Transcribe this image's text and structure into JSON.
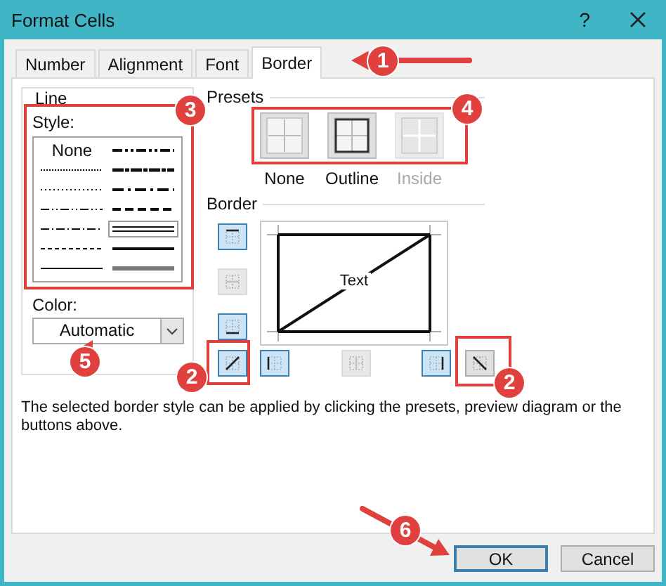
{
  "window": {
    "title": "Format Cells",
    "help": "?"
  },
  "tabs": [
    {
      "label": "Number",
      "selected": false
    },
    {
      "label": "Alignment",
      "selected": false
    },
    {
      "label": "Font",
      "selected": false
    },
    {
      "label": "Border",
      "selected": true
    }
  ],
  "line": {
    "title": "Line",
    "style_label": "Style:",
    "styles": [
      {
        "kind": "none",
        "label": "None",
        "selected": false
      },
      {
        "kind": "mdashdotdot",
        "selected": false
      },
      {
        "kind": "hair",
        "selected": false
      },
      {
        "kind": "slantdashdot",
        "selected": false
      },
      {
        "kind": "dotted",
        "selected": false
      },
      {
        "kind": "mdashdot",
        "selected": false
      },
      {
        "kind": "dashdotdot",
        "selected": false
      },
      {
        "kind": "mdashed",
        "selected": false
      },
      {
        "kind": "dashdot",
        "selected": false
      },
      {
        "kind": "double",
        "selected": true
      },
      {
        "kind": "dashed",
        "selected": false
      },
      {
        "kind": "medium",
        "selected": false
      },
      {
        "kind": "thin",
        "selected": false
      },
      {
        "kind": "thick",
        "selected": false
      }
    ],
    "color_label": "Color:",
    "color_value": "Automatic"
  },
  "presets": {
    "title": "Presets",
    "items": [
      {
        "kind": "none",
        "label": "None",
        "disabled": false
      },
      {
        "kind": "outline",
        "label": "Outline",
        "disabled": false
      },
      {
        "kind": "inside",
        "label": "Inside",
        "disabled": true
      }
    ]
  },
  "border": {
    "title": "Border",
    "preview_text": "Text",
    "side_buttons": [
      {
        "kind": "top",
        "on": true,
        "disabled": false
      },
      {
        "kind": "middle",
        "on": false,
        "disabled": true
      },
      {
        "kind": "bottom",
        "on": true,
        "disabled": false
      }
    ],
    "bottom_buttons": [
      {
        "kind": "diagonal_up",
        "on": true,
        "disabled": false
      },
      {
        "kind": "left",
        "on": true,
        "disabled": false
      },
      {
        "kind": "center",
        "on": false,
        "disabled": true
      },
      {
        "kind": "right",
        "on": true,
        "disabled": false
      },
      {
        "kind": "diagonal_down",
        "on": false,
        "disabled": false
      }
    ]
  },
  "help_text": "The selected border style can be applied by clicking the presets, preview diagram or the buttons above.",
  "buttons": [
    {
      "label": "OK",
      "default": true
    },
    {
      "label": "Cancel",
      "default": false
    }
  ],
  "annotations": [
    {
      "label": "1"
    },
    {
      "label": "3"
    },
    {
      "label": "4"
    },
    {
      "label": "2"
    },
    {
      "label": "2"
    },
    {
      "label": "5"
    },
    {
      "label": "6"
    }
  ]
}
